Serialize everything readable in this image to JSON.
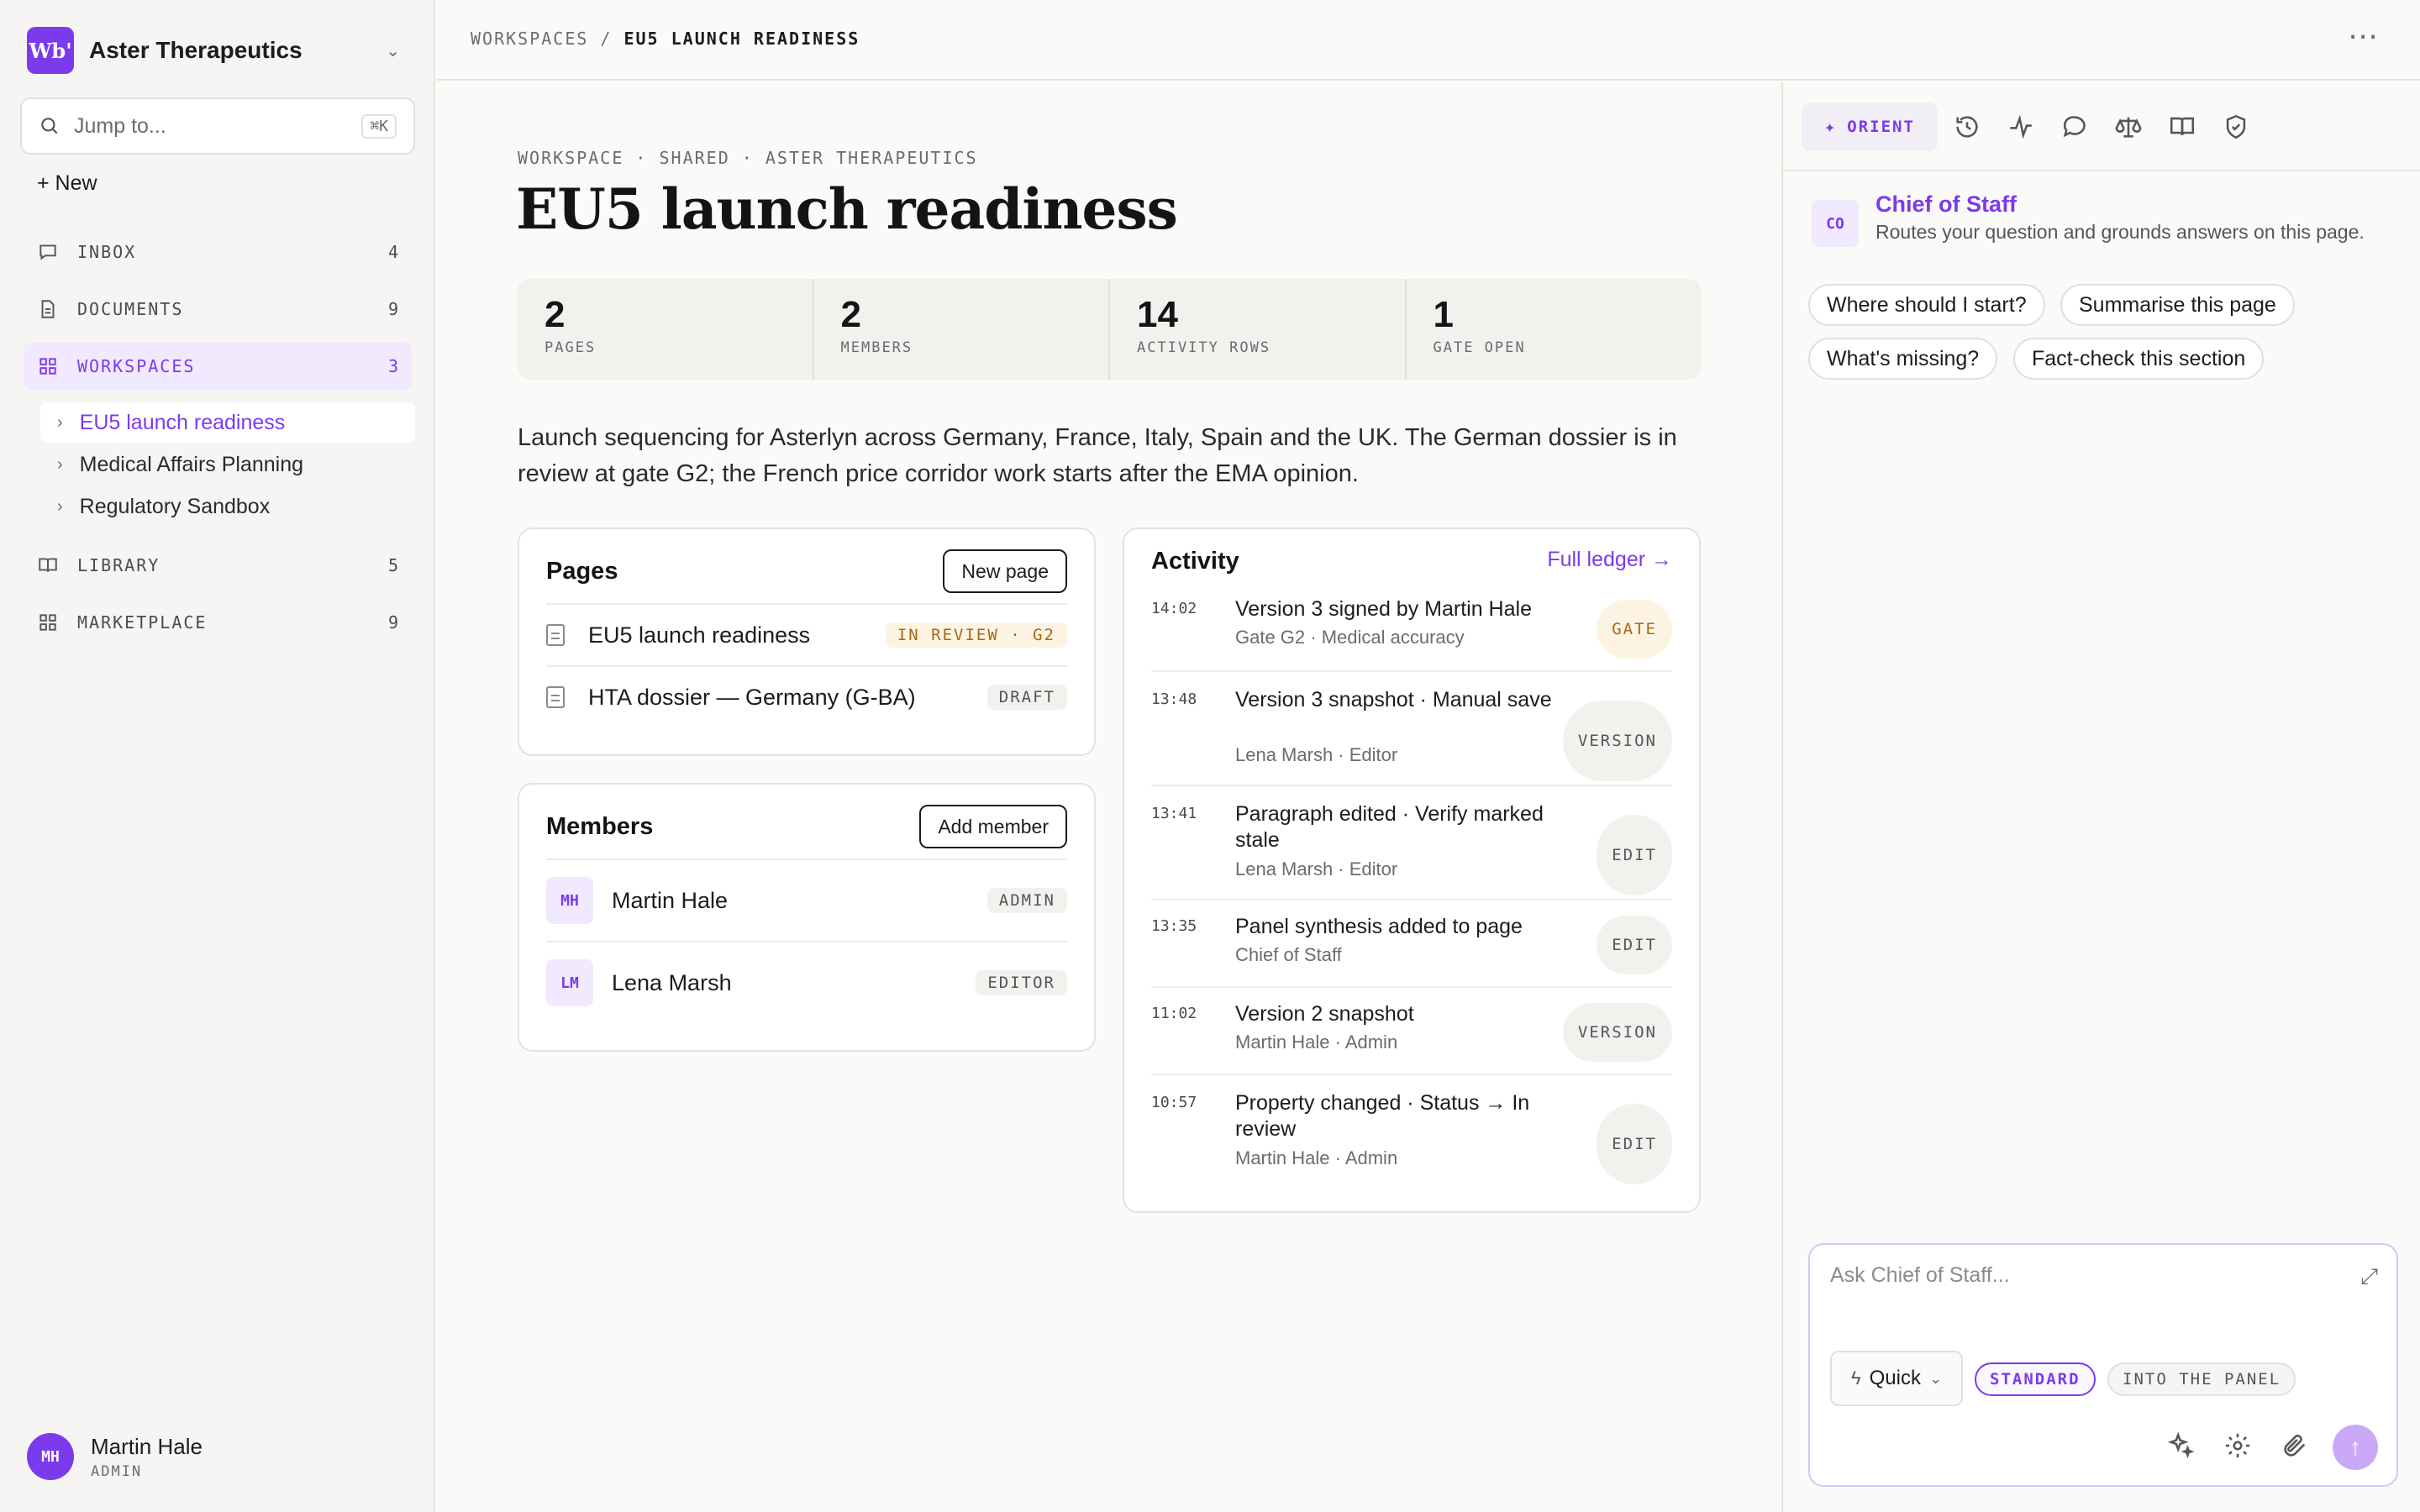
{
  "workspace": {
    "logo": "Wb'",
    "name": "Aster Therapeutics"
  },
  "search": {
    "placeholder": "Jump to...",
    "shortcut": "⌘K"
  },
  "sidebar": {
    "new_label": "+ New",
    "nav": [
      {
        "label": "INBOX",
        "count": "4",
        "icon": "inbox-icon"
      },
      {
        "label": "DOCUMENTS",
        "count": "9",
        "icon": "document-icon"
      },
      {
        "label": "WORKSPACES",
        "count": "3",
        "icon": "grid-icon"
      },
      {
        "label": "LIBRARY",
        "count": "5",
        "icon": "book-icon"
      },
      {
        "label": "MARKETPLACE",
        "count": "9",
        "icon": "grid-icon"
      }
    ],
    "workspaces": [
      {
        "label": "EU5 launch readiness"
      },
      {
        "label": "Medical Affairs Planning"
      },
      {
        "label": "Regulatory Sandbox"
      }
    ],
    "user": {
      "initials": "MH",
      "name": "Martin Hale",
      "role": "ADMIN"
    }
  },
  "breadcrumb": {
    "root": "WORKSPACES",
    "separator": "/",
    "current": "EU5 LAUNCH READINESS"
  },
  "page": {
    "eyebrow": "WORKSPACE · SHARED · ASTER THERAPEUTICS",
    "title": "EU5 launch readiness",
    "stats": [
      {
        "value": "2",
        "label": "PAGES"
      },
      {
        "value": "2",
        "label": "MEMBERS"
      },
      {
        "value": "14",
        "label": "ACTIVITY ROWS"
      },
      {
        "value": "1",
        "label": "GATE OPEN"
      }
    ],
    "description": "Launch sequencing for Asterlyn across Germany, France, Italy, Spain and the UK. The German dossier is in review at gate G2; the French price corridor work starts after the EMA opinion."
  },
  "pages_card": {
    "title": "Pages",
    "button": "New page",
    "rows": [
      {
        "title": "EU5 launch readiness",
        "tag": "IN REVIEW · G2"
      },
      {
        "title": "HTA dossier — Germany (G-BA)",
        "tag": "DRAFT"
      }
    ]
  },
  "members_card": {
    "title": "Members",
    "button": "Add member",
    "rows": [
      {
        "initials": "MH",
        "name": "Martin Hale",
        "role": "ADMIN"
      },
      {
        "initials": "LM",
        "name": "Lena Marsh",
        "role": "EDITOR"
      }
    ]
  },
  "activity": {
    "title": "Activity",
    "link": "Full ledger →",
    "rows": [
      {
        "time": "14:02",
        "title": "Version 3 signed by Martin Hale",
        "sub": "Gate G2 · Medical accuracy",
        "tag": "GATE"
      },
      {
        "time": "13:48",
        "title": "Version 3 snapshot · Manual save",
        "sub": "Lena Marsh · Editor",
        "tag": "VERSION"
      },
      {
        "time": "13:41",
        "title": "Paragraph edited · Verify marked stale",
        "sub": "Lena Marsh · Editor",
        "tag": "EDIT"
      },
      {
        "time": "13:35",
        "title": "Panel synthesis added to page",
        "sub": "Chief of Staff",
        "tag": "EDIT"
      },
      {
        "time": "11:02",
        "title": "Version 2 snapshot",
        "sub": "Martin Hale · Admin",
        "tag": "VERSION"
      },
      {
        "time": "10:57",
        "title": "Property changed · Status → In review",
        "sub": "Martin Hale · Admin",
        "tag": "EDIT"
      }
    ]
  },
  "panel": {
    "tab_active": "ORIENT",
    "tab_icons": [
      "history-icon",
      "pulse-icon",
      "comment-icon",
      "scale-icon",
      "book-icon",
      "shield-check-icon"
    ],
    "assistant": {
      "initials": "CO",
      "name": "Chief of Staff",
      "description": "Routes your question and grounds answers on this page."
    },
    "suggestions": [
      "Where should I start?",
      "Summarise this page",
      "What's missing?",
      "Fact-check this section"
    ],
    "composer": {
      "placeholder": "Ask Chief of Staff...",
      "speed": "Quick",
      "mode_on": "STANDARD",
      "mode_off": "INTO THE PANEL"
    }
  },
  "colors": {
    "accent": "#7c3aed",
    "gate": "#a66a12"
  }
}
